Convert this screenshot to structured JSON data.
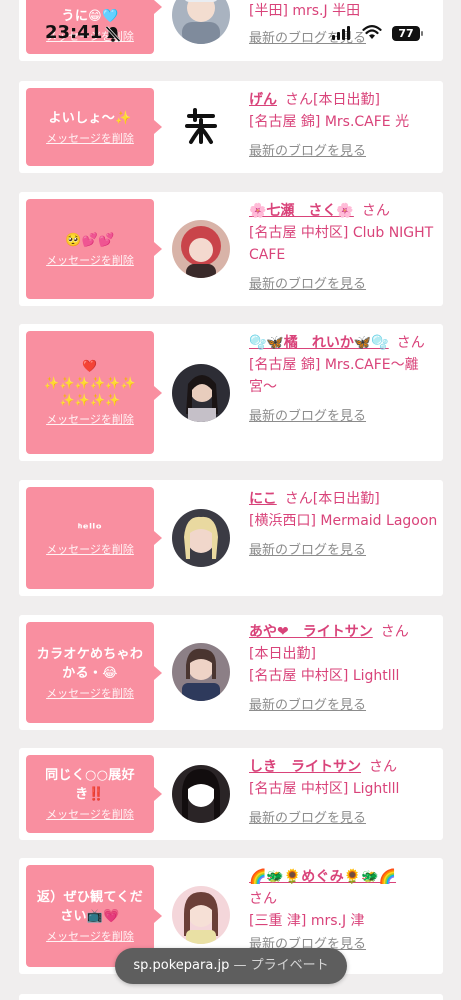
{
  "delete_label": "メッセージを削除",
  "blog_label": "最新のブログを見る",
  "san_label": "さん",
  "colors": {
    "bubble": "#f98fa0",
    "name": "#d9437a",
    "blog": "#8c8c8c",
    "background": "#f0eeee"
  },
  "status": {
    "time": "23:41",
    "battery": "77",
    "icons": [
      "bell-slash-icon",
      "signal-icon",
      "wifi-icon",
      "battery-icon"
    ]
  },
  "cards": [
    {
      "message": "うに😁🩵",
      "name": "",
      "badge": "",
      "shop": "[半田] mrs.J 半田"
    },
    {
      "message": "よいしょ〜✨",
      "name": "げん",
      "badge": "[本日出勤]",
      "shop": "[名古屋 錦] Mrs.CAFE 光"
    },
    {
      "message": "🥺💕💕",
      "name": "🌸七瀬　さく🌸",
      "badge": "",
      "shop": "[名古屋 中村区] Club NIGHT CAFE"
    },
    {
      "message": "❤️\n✨✨✨✨✨✨\n✨✨✨✨",
      "name": "🫧🦋橘　れいか🦋🫧",
      "badge": "",
      "shop": "[名古屋 錦] Mrs.CAFE〜離宮〜"
    },
    {
      "message": "ᑋᵉᑊᑊᵒ",
      "name": "にこ",
      "badge": "[本日出勤]",
      "shop": "[横浜西口] Mermaid Lagoon"
    },
    {
      "message": "カラオケめちゃわかる・😂",
      "name": "あや❤︎　ライトサン",
      "badge": "[本日出勤]",
      "shop": "[名古屋 中村区] Lightlll"
    },
    {
      "message": "同じく○○展好き‼️",
      "name": "しき　ライトサン",
      "badge": "",
      "shop": "[名古屋 中村区] Lightlll"
    },
    {
      "message": "返）ぜひ観てください📺💗",
      "name": "🌈🐲🌻めぐみ🌻🐲🌈",
      "badge": "",
      "shop": "[三重 津] mrs.J 津"
    }
  ],
  "url_bar": {
    "domain": "sp.pokepara.jp",
    "separator": " — ",
    "mode": "プライベート"
  }
}
